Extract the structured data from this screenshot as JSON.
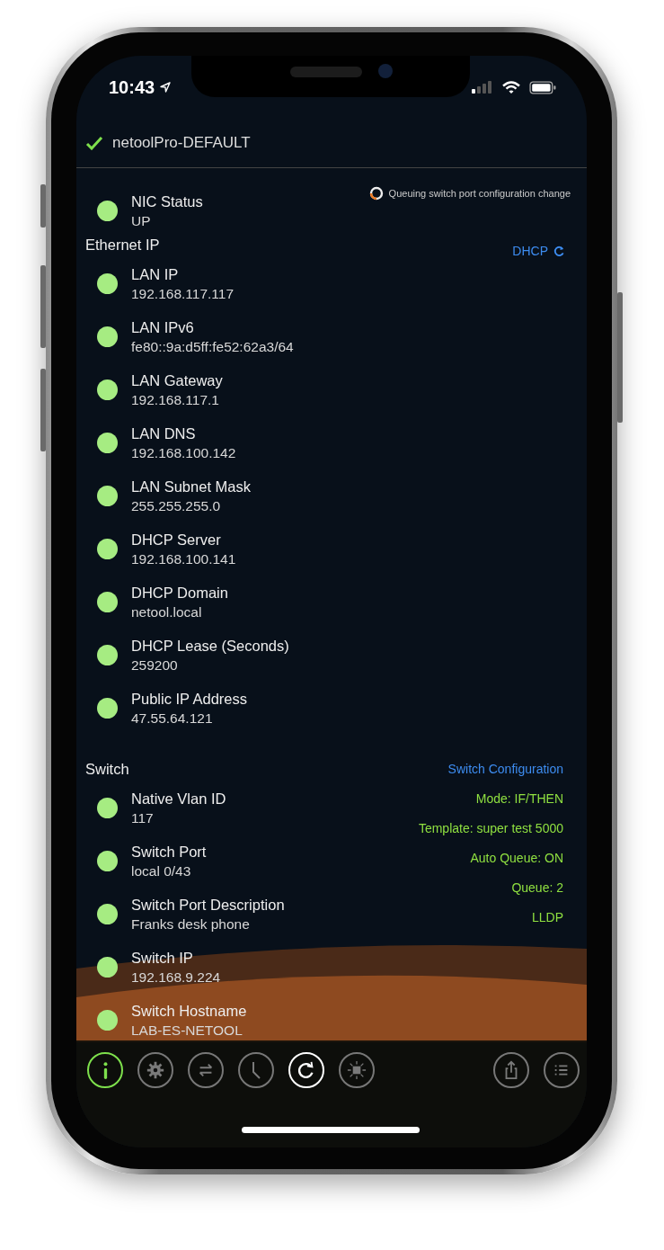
{
  "status_bar": {
    "time": "10:43"
  },
  "header": {
    "title": "netoolPro-DEFAULT",
    "connected": true
  },
  "queue_notice": "Queuing switch port configuration change",
  "nic": {
    "label": "NIC Status",
    "value": "UP"
  },
  "sections": [
    {
      "title": "Ethernet IP",
      "action": "DHCP",
      "rows": [
        {
          "label": "LAN IP",
          "value": "192.168.117.117"
        },
        {
          "label": "LAN IPv6",
          "value": "fe80::9a:d5ff:fe52:62a3/64"
        },
        {
          "label": "LAN Gateway",
          "value": "192.168.117.1"
        },
        {
          "label": "LAN DNS",
          "value": "192.168.100.142"
        },
        {
          "label": "LAN Subnet Mask",
          "value": "255.255.255.0"
        },
        {
          "label": "DHCP Server",
          "value": "192.168.100.141"
        },
        {
          "label": "DHCP Domain",
          "value": "netool.local"
        },
        {
          "label": "DHCP Lease (Seconds)",
          "value": "259200"
        },
        {
          "label": "Public IP Address",
          "value": "47.55.64.121"
        }
      ]
    },
    {
      "title": "Switch",
      "action": "Switch Configuration",
      "info": [
        "Mode: IF/THEN",
        "Template: super test 5000",
        "Auto Queue: ON",
        "Queue: 2",
        "LLDP"
      ],
      "rows": [
        {
          "label": "Native Vlan ID",
          "value": "117"
        },
        {
          "label": "Switch Port",
          "value": "local 0/43"
        },
        {
          "label": "Switch Port Description",
          "value": "Franks desk phone"
        },
        {
          "label": "Switch IP",
          "value": "192.168.9.224"
        },
        {
          "label": "Switch Hostname",
          "value": "LAB-ES-NETOOL"
        }
      ]
    }
  ],
  "toolbar": [
    {
      "kind": "info",
      "selected": true,
      "highlighted": false
    },
    {
      "kind": "settings",
      "selected": false,
      "highlighted": false
    },
    {
      "kind": "transfer",
      "selected": false,
      "highlighted": false
    },
    {
      "kind": "clock",
      "selected": false,
      "highlighted": false
    },
    {
      "kind": "refresh",
      "selected": false,
      "highlighted": true
    },
    {
      "kind": "light",
      "selected": false,
      "highlighted": false
    },
    {
      "kind": "share",
      "selected": false,
      "highlighted": false
    },
    {
      "kind": "list",
      "selected": false,
      "highlighted": false
    }
  ]
}
